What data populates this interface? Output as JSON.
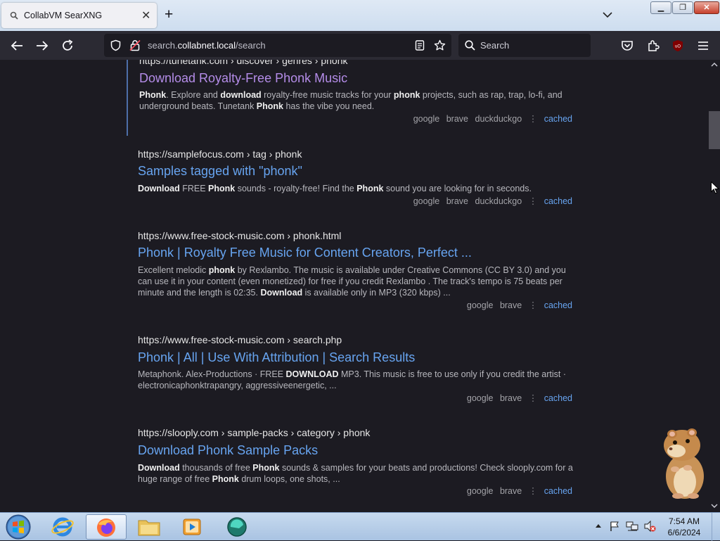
{
  "browser": {
    "tab_title": "CollabVM SearXNG",
    "url_prefix": "search.",
    "url_domain": "collabnet.local",
    "url_path": "/search",
    "search_placeholder": "Search"
  },
  "results": [
    {
      "url": "https://tunetank.com  › discover › genres › phonk",
      "title": "Download Royalty-Free Phonk Music",
      "snippet_html": "<b>Phonk</b>. Explore and <b>download</b> royalty-free music tracks for your <b>phonk</b> projects, such as rap, trap, lo-fi, and underground beats. Tunetank <b>Phonk</b> has the vibe you need.",
      "engines": [
        "google",
        "brave",
        "duckduckgo"
      ],
      "cached": "cached"
    },
    {
      "url": "https://samplefocus.com  › tag › phonk",
      "title": "Samples tagged with \"phonk\"",
      "snippet_html": "<b>Download</b> FREE <b>Phonk</b> sounds - royalty-free! Find the <b>Phonk</b> sound you are looking for in seconds.",
      "engines": [
        "google",
        "brave",
        "duckduckgo"
      ],
      "cached": "cached"
    },
    {
      "url": "https://www.free-stock-music.com  › phonk.html",
      "title": "Phonk | Royalty Free Music for Content Creators, Perfect ...",
      "snippet_html": "Excellent melodic <b>phonk</b> by Rexlambo. The music is available under Creative Commons (CC BY 3.0) and you can use it in your content (even monetized) for free if you credit Rexlambo . The track's tempo is 75 beats per minute and the length is 02:35. <b>Download</b> is available only in MP3 (320 kbps) ...",
      "engines": [
        "google",
        "brave"
      ],
      "cached": "cached"
    },
    {
      "url": "https://www.free-stock-music.com  › search.php",
      "title": "Phonk | All | Use With Attribution | Search Results",
      "snippet_html": "Metaphonk. Alex-Productions · FREE <b>DOWNLOAD</b> MP3. This music is free to use only if you credit the artist · electronicaphonktrapangry, aggressiveenergetic, ...",
      "engines": [
        "google",
        "brave"
      ],
      "cached": "cached"
    },
    {
      "url": "https://slooply.com  › sample-packs › category › phonk",
      "title": "Download Phonk Sample Packs",
      "snippet_html": "<b>Download</b> thousands of free <b>Phonk</b> sounds &amp; samples for your beats and productions! Check slooply.com for a huge range of free <b>Phonk</b> drum loops, one shots, ...",
      "engines": [
        "google",
        "brave"
      ],
      "cached": "cached"
    }
  ],
  "taskbar": {
    "time": "7:54 AM",
    "date": "6/6/2024"
  },
  "colors": {
    "page_bg": "#1c1b22",
    "link": "#67a4f0",
    "visited_link": "#b48ce8"
  }
}
